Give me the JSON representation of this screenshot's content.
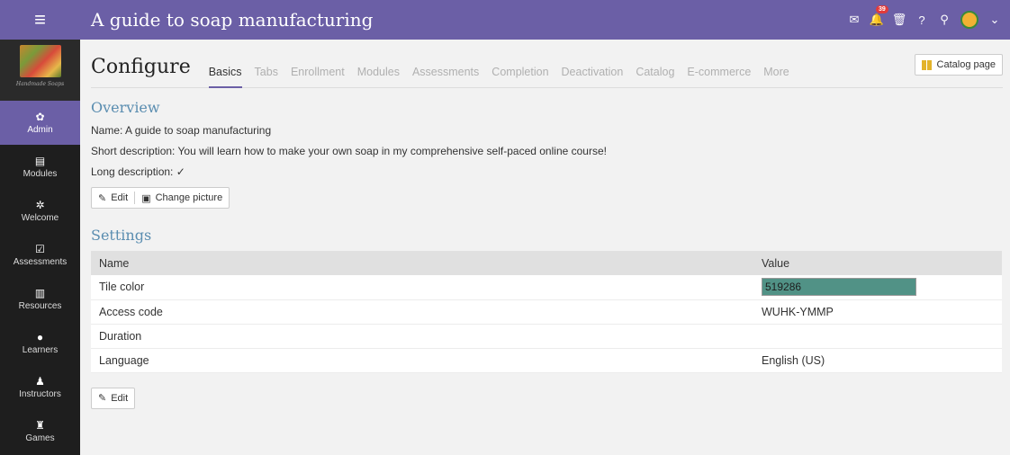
{
  "topbar": {
    "course_title": "A guide to soap manufacturing",
    "notification_count": "39"
  },
  "brand": {
    "logo_text": "Handmade Soaps"
  },
  "sidebar": {
    "items": [
      {
        "label": "Admin",
        "icon": "gear-icon",
        "active": true
      },
      {
        "label": "Modules",
        "icon": "modules-icon"
      },
      {
        "label": "Welcome",
        "icon": "welcome-icon"
      },
      {
        "label": "Assessments",
        "icon": "assessments-icon"
      },
      {
        "label": "Resources",
        "icon": "resources-icon"
      },
      {
        "label": "Learners",
        "icon": "learners-icon"
      },
      {
        "label": "Instructors",
        "icon": "instructors-icon"
      },
      {
        "label": "Games",
        "icon": "trophy-icon"
      }
    ]
  },
  "header": {
    "title": "Configure",
    "catalog_button": "Catalog page",
    "tabs": [
      "Basics",
      "Tabs",
      "Enrollment",
      "Modules",
      "Assessments",
      "Completion",
      "Deactivation",
      "Catalog",
      "E-commerce",
      "More"
    ],
    "active_tab": "Basics"
  },
  "overview": {
    "title": "Overview",
    "name_line": "Name: A guide to soap manufacturing",
    "short_description_line": "Short description: You will learn how to make your own soap in my comprehensive self-paced online course!",
    "long_description_label": "Long description:",
    "long_description_mark": "✓",
    "edit_label": "Edit",
    "change_picture_label": "Change picture"
  },
  "settings": {
    "title": "Settings",
    "col_name": "Name",
    "col_value": "Value",
    "rows": [
      {
        "name": "Tile color",
        "value": "519286"
      },
      {
        "name": "Access code",
        "value": "WUHK-YMMP"
      },
      {
        "name": "Duration",
        "value": ""
      },
      {
        "name": "Language",
        "value": "English (US)"
      }
    ],
    "edit_label": "Edit"
  },
  "colors": {
    "accent": "#6b5fa6",
    "section_title": "#5a8db0",
    "tile_color": "#519286",
    "badge": "#e23b3b"
  }
}
